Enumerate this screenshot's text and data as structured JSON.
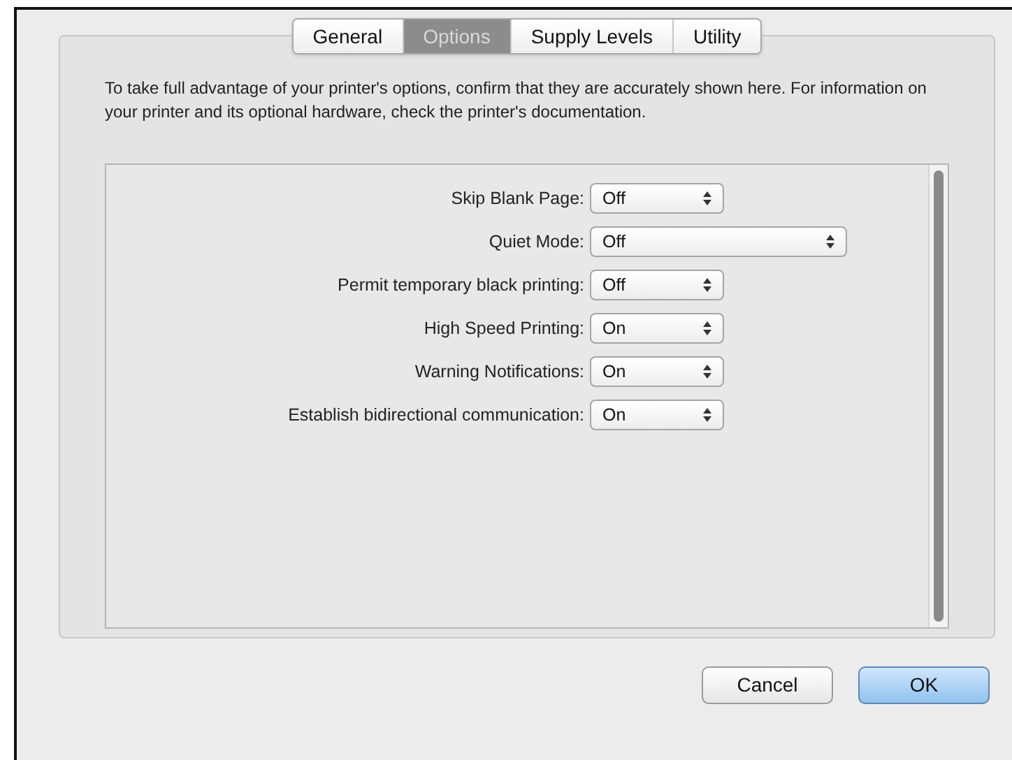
{
  "tabs": [
    {
      "label": "General",
      "selected": false
    },
    {
      "label": "Options",
      "selected": true
    },
    {
      "label": "Supply Levels",
      "selected": false
    },
    {
      "label": "Utility",
      "selected": false
    }
  ],
  "description": "To take full advantage of your printer's options, confirm that they are accurately shown here. For information on your printer and its optional hardware, check the printer's documentation.",
  "options": [
    {
      "label": "Skip Blank Page:",
      "value": "Off",
      "kind": "narrow"
    },
    {
      "label": "Quiet Mode:",
      "value": "Off",
      "kind": "wide"
    },
    {
      "label": "Permit temporary black printing:",
      "value": "Off",
      "kind": "narrow"
    },
    {
      "label": "High Speed Printing:",
      "value": "On",
      "kind": "narrow"
    },
    {
      "label": "Warning Notifications:",
      "value": "On",
      "kind": "narrow"
    },
    {
      "label": "Establish bidirectional communication:",
      "value": "On",
      "kind": "narrow"
    }
  ],
  "buttons": [
    {
      "label": "Cancel",
      "kind": "secondary"
    },
    {
      "label": "OK",
      "kind": "default"
    }
  ]
}
